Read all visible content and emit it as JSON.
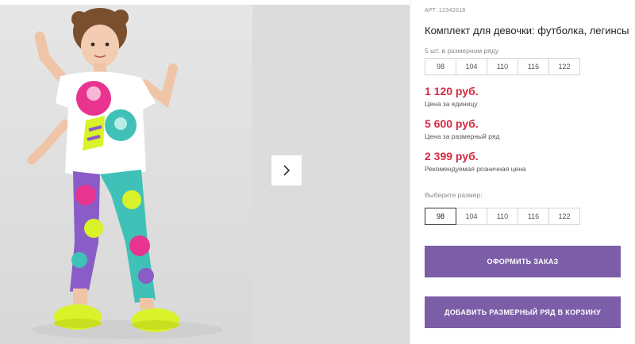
{
  "article": {
    "label": "АРТ.",
    "value": "12342018"
  },
  "product": {
    "title": "Комплект для девочки: футболка, легинсы"
  },
  "size_row": {
    "hint": "5 шт. в размерном ряду",
    "sizes": [
      "98",
      "104",
      "110",
      "116",
      "122"
    ]
  },
  "prices": [
    {
      "value": "1 120 руб.",
      "caption": "Цена за единицу"
    },
    {
      "value": "5 600 руб.",
      "caption": "Цена за размерный ряд"
    },
    {
      "value": "2 399 руб.",
      "caption": "Рекомендуемая розничная цена"
    }
  ],
  "size_select": {
    "label": "Выберите размер:",
    "sizes": [
      "98",
      "104",
      "110",
      "116",
      "122"
    ],
    "selected": "98"
  },
  "buttons": {
    "order": "ОФОРМИТЬ ЗАКАЗ",
    "add_to_cart": "ДОБАВИТЬ РАЗМЕРНЫЙ РЯД В КОРЗИНУ"
  },
  "colors": {
    "price": "#d6283f",
    "button": "#7b5ea7",
    "leggings_pink": "#e8348f",
    "leggings_teal": "#3fc1b8",
    "leggings_purple": "#8a5cc7",
    "shoes": "#d9f22a"
  },
  "icons": {
    "gallery_next": "chevron-right-icon"
  }
}
